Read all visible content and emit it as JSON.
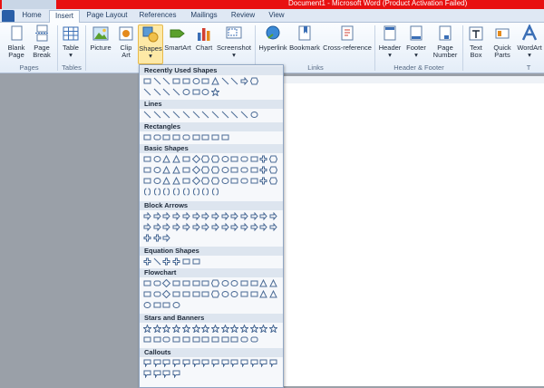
{
  "window": {
    "title": "Document1 - Microsoft Word (Product Activation Failed)"
  },
  "tabs": [
    "Home",
    "Insert",
    "Page Layout",
    "References",
    "Mailings",
    "Review",
    "View"
  ],
  "active_tab": "Insert",
  "ribbon": {
    "blank_page": [
      "Blank",
      "Page"
    ],
    "page_break": [
      "Page",
      "Break"
    ],
    "table": "Table",
    "picture": "Picture",
    "clip_art": [
      "Clip",
      "Art"
    ],
    "shapes": "Shapes",
    "smartart": "SmartArt",
    "chart": "Chart",
    "screenshot": "Screenshot",
    "hyperlink": "Hyperlink",
    "bookmark": "Bookmark",
    "cross_reference": "Cross-reference",
    "header": "Header",
    "footer": "Footer",
    "page_number": [
      "Page",
      "Number"
    ],
    "text_box": [
      "Text",
      "Box"
    ],
    "quick_parts": [
      "Quick",
      "Parts"
    ],
    "wordart": "WordArt",
    "groups": {
      "pages": "Pages",
      "tables": "Tables",
      "links": "Links",
      "header_footer": "Header & Footer",
      "text": "T"
    }
  },
  "shapes_menu": {
    "sections": [
      "Recently Used Shapes",
      "Lines",
      "Rectangles",
      "Basic Shapes",
      "Block Arrows",
      "Equation Shapes",
      "Flowchart",
      "Stars and Banners",
      "Callouts"
    ]
  },
  "colors": {
    "title_bar": "#e81010",
    "file_tab": "#2a5fa8",
    "highlight": "#fde9a6",
    "icon_blue": "#3b6fb6",
    "icon_orange": "#e48a1c",
    "icon_green": "#5aa02c"
  }
}
